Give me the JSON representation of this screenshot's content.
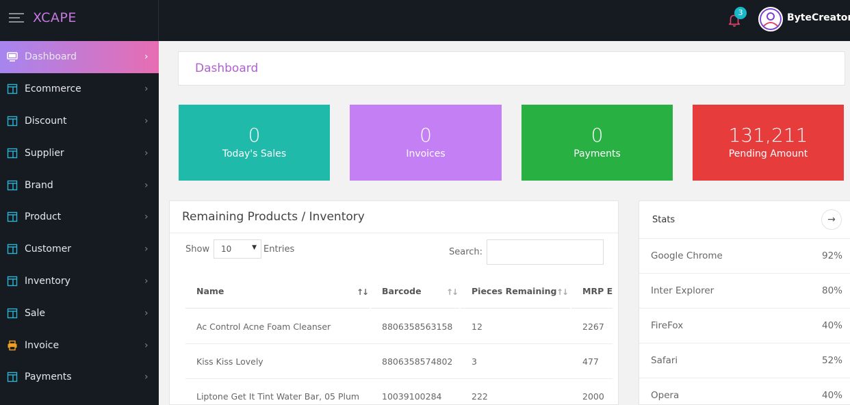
{
  "app": {
    "logo": "XCAPE",
    "notifications_count": "3",
    "user_name": "ByteCreators"
  },
  "sidebar": {
    "items": [
      {
        "label": "Dashboard",
        "icon": "monitor-icon",
        "active": true
      },
      {
        "label": "Ecommerce",
        "icon": "layout-icon"
      },
      {
        "label": "Discount",
        "icon": "layout-icon"
      },
      {
        "label": "Supplier",
        "icon": "layout-icon"
      },
      {
        "label": "Brand",
        "icon": "layout-icon"
      },
      {
        "label": "Product",
        "icon": "layout-icon"
      },
      {
        "label": "Customer",
        "icon": "layout-icon"
      },
      {
        "label": "Inventory",
        "icon": "layout-icon"
      },
      {
        "label": "Sale",
        "icon": "layout-icon"
      },
      {
        "label": "Invoice",
        "icon": "printer-icon"
      },
      {
        "label": "Payments",
        "icon": "layout-icon"
      }
    ],
    "chevron": "›"
  },
  "page": {
    "title": "Dashboard"
  },
  "stats_cards": [
    {
      "value": "0",
      "label": "Today's Sales",
      "color": "#1fbaa9"
    },
    {
      "value": "0",
      "label": "Invoices",
      "color": "#c47ff5"
    },
    {
      "value": "0",
      "label": "Payments",
      "color": "#28b043"
    },
    {
      "value": "131,211",
      "label": "Pending Amount",
      "color": "#e63c3c"
    }
  ],
  "inventory": {
    "title": "Remaining Products / Inventory",
    "show_label": "Show",
    "entries_value": "10",
    "entries_label": "Entries",
    "search_label": "Search:",
    "search_value": "",
    "columns": [
      "Name",
      "Barcode",
      "Pieces Remaining",
      "MRP Ex"
    ],
    "rows": [
      [
        "Ac Control Acne Foam Cleanser",
        "8806358563158",
        "12",
        "2267"
      ],
      [
        "Kiss Kiss Lovely",
        "8806358574802",
        "3",
        "477"
      ],
      [
        "Liptone Get It Tint Water Bar, 05 Plum",
        "10039100284",
        "222",
        "2000"
      ]
    ]
  },
  "stats": {
    "title": "Stats",
    "rows": [
      {
        "name": "Google Chrome",
        "value": "92%"
      },
      {
        "name": "Inter Explorer",
        "value": "80%"
      },
      {
        "name": "FireFox",
        "value": "40%"
      },
      {
        "name": "Safari",
        "value": "52%"
      },
      {
        "name": "Opera",
        "value": "40%"
      }
    ]
  }
}
